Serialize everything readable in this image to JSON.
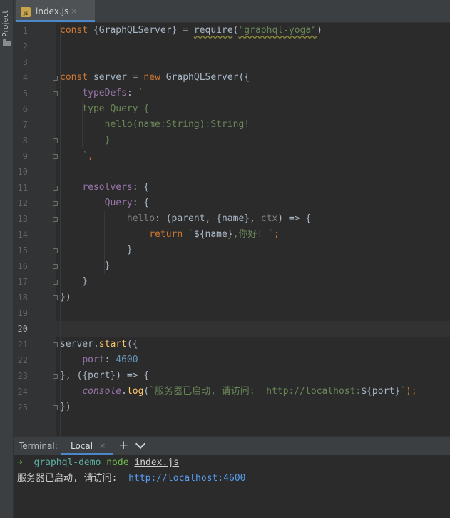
{
  "sidebar": {
    "project_label": "Project"
  },
  "editor": {
    "tab": {
      "icon_text": "JS",
      "filename": "index.js",
      "close": "×"
    },
    "line_numbers": [
      "1",
      "2",
      "3",
      "4",
      "5",
      "6",
      "7",
      "8",
      "9",
      "10",
      "11",
      "12",
      "13",
      "14",
      "15",
      "16",
      "17",
      "18",
      "19",
      "20",
      "21",
      "22",
      "23",
      "24",
      "25"
    ],
    "current_line": "20",
    "code": {
      "l1": {
        "a": "const ",
        "b": "{GraphQLServer} = ",
        "c": "require",
        "d": "(",
        "e": "\"graphql-yoga\"",
        "f": ")"
      },
      "l4": {
        "a": "const ",
        "b": "server = ",
        "c": "new ",
        "d": "GraphQLServer({"
      },
      "l5": {
        "a": "    ",
        "b": "typeDefs",
        "c": ": ",
        "d": "`"
      },
      "l6": {
        "a": "    type Query {"
      },
      "l7": {
        "a": "        hello(name:String):String!"
      },
      "l8": {
        "a": "        }"
      },
      "l9": {
        "a": "    `",
        "b": ","
      },
      "l11": {
        "a": "    ",
        "b": "resolvers",
        "c": ": {"
      },
      "l12": {
        "a": "        ",
        "b": "Query",
        "c": ": {"
      },
      "l13": {
        "a": "            ",
        "b": "hello",
        "c": ": (parent, {",
        "d": "name",
        "e": "}, ",
        "f": "ctx",
        "g": ") => {"
      },
      "l14": {
        "a": "                ",
        "b": "return ",
        "c": "`",
        "d": "${name}",
        "e": ",你好! `",
        "f": ";"
      },
      "l15": {
        "a": "            }"
      },
      "l16": {
        "a": "        }"
      },
      "l17": {
        "a": "    }"
      },
      "l18": {
        "a": "})"
      },
      "l21": {
        "a": "server.",
        "b": "start",
        "c": "({"
      },
      "l22": {
        "a": "    ",
        "b": "port",
        "c": ": ",
        "d": "4600"
      },
      "l23": {
        "a": "}, ({port}) => {"
      },
      "l24": {
        "a": "    ",
        "b": "console",
        "c": ".",
        "d": "log",
        "e": "(",
        "f": "`服务器已启动, 请访问:  http://localhost:",
        "g": "${port}",
        "h": "`",
        "i": ");"
      },
      "l25": {
        "a": "})"
      }
    }
  },
  "terminal": {
    "title": "Terminal:",
    "tab_label": "Local",
    "tab_close": "×",
    "add": "+",
    "prompt_arrow": "➜",
    "cwd": "graphql-demo",
    "command": "node",
    "arg": "index.js",
    "output_prefix": "服务器已启动, 请访问:  ",
    "output_link": "http://localhost:4600"
  },
  "colors": {
    "background": "#2b2b2b",
    "keyword": "#cc7832",
    "string": "#6a8759",
    "number": "#6897bb",
    "property": "#9876aa",
    "accent": "#4a88c7"
  }
}
